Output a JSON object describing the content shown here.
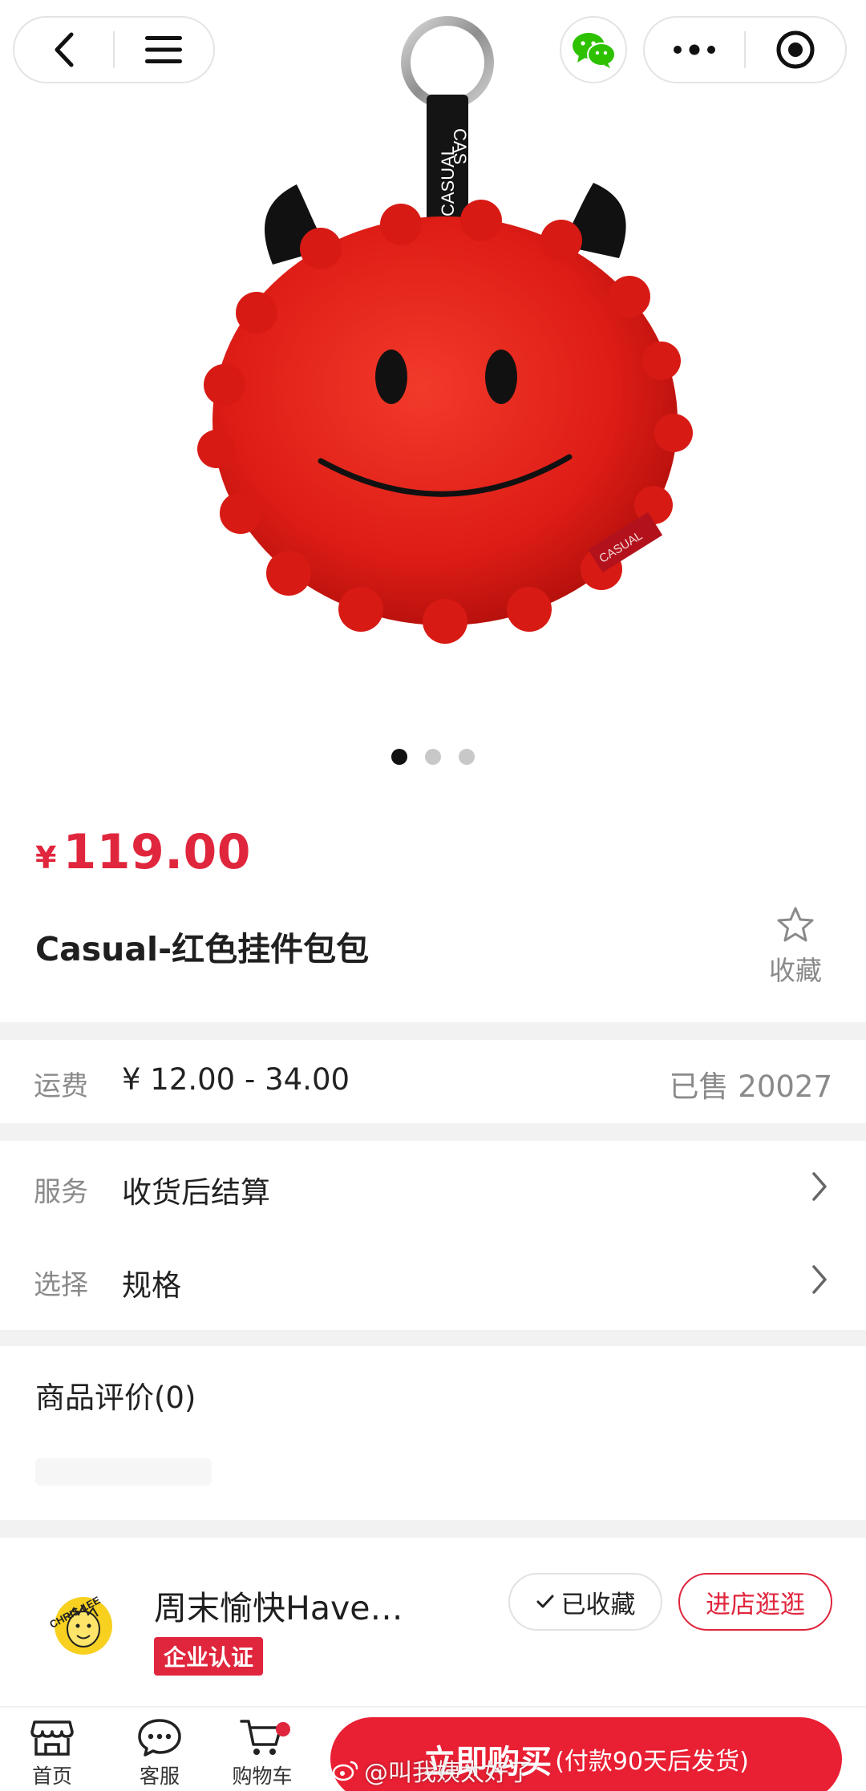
{
  "product": {
    "currency_symbol": "¥",
    "price": "119.00",
    "title": "Casual-红色挂件包包",
    "favorite_label": "收藏",
    "image_brand_tag": "CASUAL",
    "image_strap_text": "CASUAL CAS",
    "gallery": {
      "count": 3,
      "active_index": 0
    }
  },
  "shipping": {
    "label": "运费",
    "value": "¥ 12.00 - 34.00",
    "sold": "已售 20027"
  },
  "options": [
    {
      "label": "服务",
      "value": "收货后结算"
    },
    {
      "label": "选择",
      "value": "规格"
    }
  ],
  "reviews": {
    "title": "商品评价(0)"
  },
  "store": {
    "name": "周末愉快Have…",
    "certification": "企业认证",
    "followed_label": "已收藏",
    "visit_label": "进店逛逛",
    "logo_text": "CHRIS LEE"
  },
  "bottom_bar": {
    "tabs": [
      {
        "label": "首页",
        "icon": "store-icon"
      },
      {
        "label": "客服",
        "icon": "chat-icon"
      },
      {
        "label": "购物车",
        "icon": "cart-icon"
      }
    ],
    "buy_label": "立即购买",
    "buy_sub": "(付款90天后发货)"
  },
  "watermark": "@叫我姨太好了",
  "colors": {
    "accent_red": "#e0263d",
    "buy_red": "#e91f33",
    "wechat_green": "#2dc100"
  }
}
